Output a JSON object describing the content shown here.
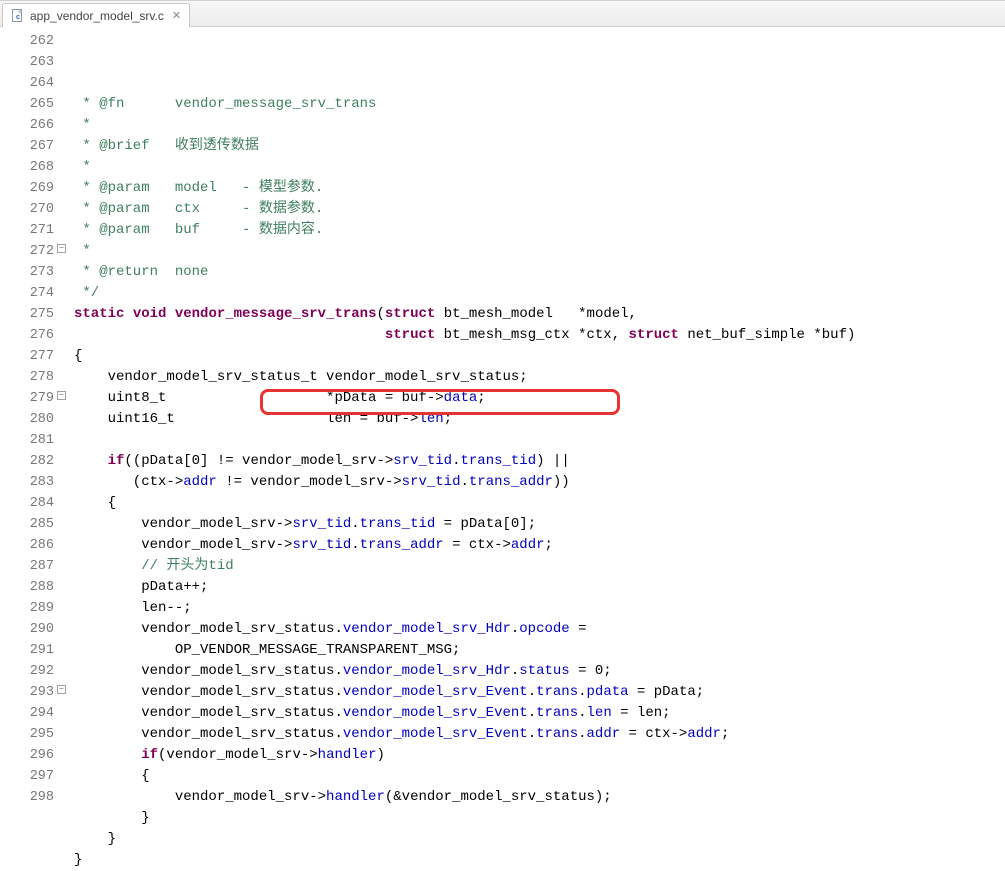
{
  "tab": {
    "filename": "app_vendor_model_srv.c",
    "close_glyph": "✕"
  },
  "gutter": {
    "start": 262,
    "end": 298,
    "fold_lines": [
      272,
      279,
      293
    ]
  },
  "highlight": {
    "text": "vendor_model_srv->srv_tid.trans_tid)"
  },
  "code_lines": [
    {
      "n": 262,
      "t": "comment",
      "text": " * @fn      vendor_message_srv_trans"
    },
    {
      "n": 263,
      "t": "comment",
      "text": " *"
    },
    {
      "n": 264,
      "t": "comment",
      "text": " * @brief   收到透传数据"
    },
    {
      "n": 265,
      "t": "comment",
      "text": " *"
    },
    {
      "n": 266,
      "t": "comment",
      "text": " * @param   model   - 模型参数."
    },
    {
      "n": 267,
      "t": "comment",
      "text": " * @param   ctx     - 数据参数."
    },
    {
      "n": 268,
      "t": "comment",
      "text": " * @param   buf     - 数据内容."
    },
    {
      "n": 269,
      "t": "comment",
      "text": " *"
    },
    {
      "n": 270,
      "t": "comment",
      "text": " * @return  none"
    },
    {
      "n": 271,
      "t": "comment",
      "text": " */"
    },
    {
      "n": 272,
      "t": "sig",
      "segs": [
        {
          "c": "keyword",
          "s": "static"
        },
        {
          "c": "plain",
          "s": " "
        },
        {
          "c": "keyword",
          "s": "void"
        },
        {
          "c": "plain",
          "s": " "
        },
        {
          "c": "keyword",
          "s": "vendor_message_srv_trans"
        },
        {
          "c": "plain",
          "s": "("
        },
        {
          "c": "keyword",
          "s": "struct"
        },
        {
          "c": "plain",
          "s": " bt_mesh_model   *model,"
        }
      ]
    },
    {
      "n": 273,
      "t": "sig",
      "segs": [
        {
          "c": "plain",
          "s": "                                     "
        },
        {
          "c": "keyword",
          "s": "struct"
        },
        {
          "c": "plain",
          "s": " bt_mesh_msg_ctx *ctx, "
        },
        {
          "c": "keyword",
          "s": "struct"
        },
        {
          "c": "plain",
          "s": " net_buf_simple *buf)"
        }
      ]
    },
    {
      "n": 274,
      "t": "plain",
      "text": "{"
    },
    {
      "n": 275,
      "t": "plain",
      "text": "    vendor_model_srv_status_t vendor_model_srv_status;"
    },
    {
      "n": 276,
      "t": "code",
      "segs": [
        {
          "c": "plain",
          "s": "    uint8_t                   *pData = buf->"
        },
        {
          "c": "member",
          "s": "data"
        },
        {
          "c": "plain",
          "s": ";"
        }
      ]
    },
    {
      "n": 277,
      "t": "code",
      "segs": [
        {
          "c": "plain",
          "s": "    uint16_t                  len = buf->"
        },
        {
          "c": "member",
          "s": "len"
        },
        {
          "c": "plain",
          "s": ";"
        }
      ]
    },
    {
      "n": 278,
      "t": "plain",
      "text": ""
    },
    {
      "n": 279,
      "t": "code",
      "segs": [
        {
          "c": "plain",
          "s": "    "
        },
        {
          "c": "keyword",
          "s": "if"
        },
        {
          "c": "plain",
          "s": "((pData[0] != vendor_model_srv->"
        },
        {
          "c": "member",
          "s": "srv_tid"
        },
        {
          "c": "plain",
          "s": "."
        },
        {
          "c": "member",
          "s": "trans_tid"
        },
        {
          "c": "plain",
          "s": ") ||"
        }
      ]
    },
    {
      "n": 280,
      "t": "code",
      "segs": [
        {
          "c": "plain",
          "s": "       (ctx->"
        },
        {
          "c": "member",
          "s": "addr"
        },
        {
          "c": "plain",
          "s": " != vendor_model_srv->"
        },
        {
          "c": "member",
          "s": "srv_tid"
        },
        {
          "c": "plain",
          "s": "."
        },
        {
          "c": "member",
          "s": "trans_addr"
        },
        {
          "c": "plain",
          "s": "))"
        }
      ]
    },
    {
      "n": 281,
      "t": "plain",
      "text": "    {"
    },
    {
      "n": 282,
      "t": "code",
      "segs": [
        {
          "c": "plain",
          "s": "        vendor_model_srv->"
        },
        {
          "c": "member",
          "s": "srv_tid"
        },
        {
          "c": "plain",
          "s": "."
        },
        {
          "c": "member",
          "s": "trans_tid"
        },
        {
          "c": "plain",
          "s": " = pData[0];"
        }
      ]
    },
    {
      "n": 283,
      "t": "code",
      "segs": [
        {
          "c": "plain",
          "s": "        vendor_model_srv->"
        },
        {
          "c": "member",
          "s": "srv_tid"
        },
        {
          "c": "plain",
          "s": "."
        },
        {
          "c": "member",
          "s": "trans_addr"
        },
        {
          "c": "plain",
          "s": " = ctx->"
        },
        {
          "c": "member",
          "s": "addr"
        },
        {
          "c": "plain",
          "s": ";"
        }
      ]
    },
    {
      "n": 284,
      "t": "comment",
      "text": "        // 开头为tid"
    },
    {
      "n": 285,
      "t": "plain",
      "text": "        pData++;"
    },
    {
      "n": 286,
      "t": "plain",
      "text": "        len--;"
    },
    {
      "n": 287,
      "t": "code",
      "segs": [
        {
          "c": "plain",
          "s": "        vendor_model_srv_status."
        },
        {
          "c": "member",
          "s": "vendor_model_srv_Hdr"
        },
        {
          "c": "plain",
          "s": "."
        },
        {
          "c": "member",
          "s": "opcode"
        },
        {
          "c": "plain",
          "s": " ="
        }
      ]
    },
    {
      "n": 288,
      "t": "plain",
      "text": "            OP_VENDOR_MESSAGE_TRANSPARENT_MSG;"
    },
    {
      "n": 289,
      "t": "code",
      "segs": [
        {
          "c": "plain",
          "s": "        vendor_model_srv_status."
        },
        {
          "c": "member",
          "s": "vendor_model_srv_Hdr"
        },
        {
          "c": "plain",
          "s": "."
        },
        {
          "c": "member",
          "s": "status"
        },
        {
          "c": "plain",
          "s": " = 0;"
        }
      ]
    },
    {
      "n": 290,
      "t": "code",
      "segs": [
        {
          "c": "plain",
          "s": "        vendor_model_srv_status."
        },
        {
          "c": "member",
          "s": "vendor_model_srv_Event"
        },
        {
          "c": "plain",
          "s": "."
        },
        {
          "c": "member",
          "s": "trans"
        },
        {
          "c": "plain",
          "s": "."
        },
        {
          "c": "member",
          "s": "pdata"
        },
        {
          "c": "plain",
          "s": " = pData;"
        }
      ]
    },
    {
      "n": 291,
      "t": "code",
      "segs": [
        {
          "c": "plain",
          "s": "        vendor_model_srv_status."
        },
        {
          "c": "member",
          "s": "vendor_model_srv_Event"
        },
        {
          "c": "plain",
          "s": "."
        },
        {
          "c": "member",
          "s": "trans"
        },
        {
          "c": "plain",
          "s": "."
        },
        {
          "c": "member",
          "s": "len"
        },
        {
          "c": "plain",
          "s": " = len;"
        }
      ]
    },
    {
      "n": 292,
      "t": "code",
      "segs": [
        {
          "c": "plain",
          "s": "        vendor_model_srv_status."
        },
        {
          "c": "member",
          "s": "vendor_model_srv_Event"
        },
        {
          "c": "plain",
          "s": "."
        },
        {
          "c": "member",
          "s": "trans"
        },
        {
          "c": "plain",
          "s": "."
        },
        {
          "c": "member",
          "s": "addr"
        },
        {
          "c": "plain",
          "s": " = ctx->"
        },
        {
          "c": "member",
          "s": "addr"
        },
        {
          "c": "plain",
          "s": ";"
        }
      ]
    },
    {
      "n": 293,
      "t": "code",
      "segs": [
        {
          "c": "plain",
          "s": "        "
        },
        {
          "c": "keyword",
          "s": "if"
        },
        {
          "c": "plain",
          "s": "(vendor_model_srv->"
        },
        {
          "c": "member",
          "s": "handler"
        },
        {
          "c": "plain",
          "s": ")"
        }
      ]
    },
    {
      "n": 294,
      "t": "plain",
      "text": "        {"
    },
    {
      "n": 295,
      "t": "code",
      "segs": [
        {
          "c": "plain",
          "s": "            vendor_model_srv->"
        },
        {
          "c": "member",
          "s": "handler"
        },
        {
          "c": "plain",
          "s": "(&vendor_model_srv_status);"
        }
      ]
    },
    {
      "n": 296,
      "t": "plain",
      "text": "        }"
    },
    {
      "n": 297,
      "t": "plain",
      "text": "    }"
    },
    {
      "n": 298,
      "t": "plain",
      "text": "}"
    }
  ]
}
